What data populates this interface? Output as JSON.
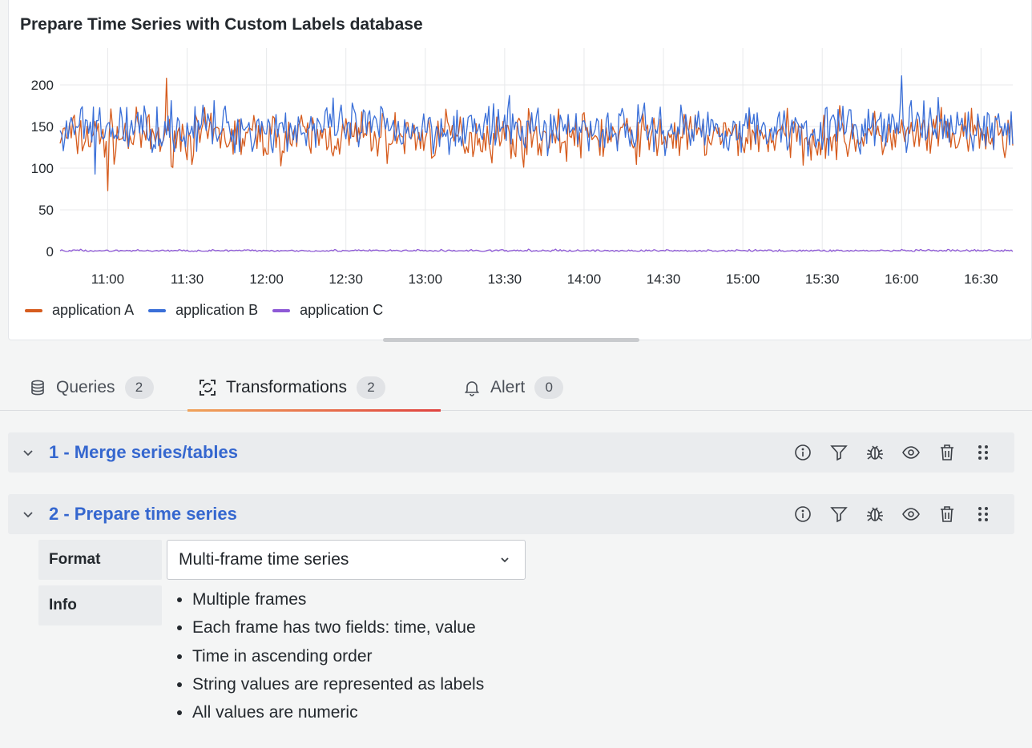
{
  "panel": {
    "title": "Prepare Time Series with Custom Labels database"
  },
  "chart_data": {
    "type": "line",
    "title": "Prepare Time Series with Custom Labels database",
    "x_ticks": [
      "11:00",
      "11:30",
      "12:00",
      "12:30",
      "13:00",
      "13:30",
      "14:00",
      "14:30",
      "15:00",
      "15:30",
      "16:00",
      "16:30"
    ],
    "xlim": [
      "10:42",
      "16:42"
    ],
    "y_ticks": [
      0,
      50,
      100,
      150,
      200
    ],
    "ylim": [
      0,
      225
    ],
    "grid": true,
    "legend_position": "bottom-left",
    "series": [
      {
        "name": "application A",
        "color": "#d65c1e",
        "mean": 138,
        "spread": 22,
        "peak": [
          208,
          "11:22"
        ],
        "min": [
          73,
          "11:00"
        ]
      },
      {
        "name": "application B",
        "color": "#3a6fd8",
        "mean": 148,
        "spread": 22,
        "peak": [
          211,
          "16:00"
        ],
        "min": [
          93,
          "10:55"
        ]
      },
      {
        "name": "application C",
        "color": "#8e59d6",
        "mean": 1,
        "spread": 1
      }
    ]
  },
  "legend": {
    "items": [
      {
        "label": "application A",
        "color": "#d65c1e"
      },
      {
        "label": "application B",
        "color": "#3a6fd8"
      },
      {
        "label": "application C",
        "color": "#8e59d6"
      }
    ]
  },
  "tabs": [
    {
      "label": "Queries",
      "count": "2",
      "icon": "database-icon"
    },
    {
      "label": "Transformations",
      "count": "2",
      "icon": "transform-icon"
    },
    {
      "label": "Alert",
      "count": "0",
      "icon": "bell-icon"
    }
  ],
  "transformations": [
    {
      "title": "1 - Merge series/tables"
    },
    {
      "title": "2 - Prepare time series"
    }
  ],
  "options": {
    "format_label": "Format",
    "format_value": "Multi-frame time series",
    "info_label": "Info",
    "info_items": [
      "Multiple frames",
      "Each frame has two fields: time, value",
      "Time in ascending order",
      "String values are represented as labels",
      "All values are numeric"
    ]
  },
  "actions": [
    "info-icon",
    "filter-icon",
    "debug-icon",
    "eye-icon",
    "trash-icon",
    "drag-icon"
  ]
}
